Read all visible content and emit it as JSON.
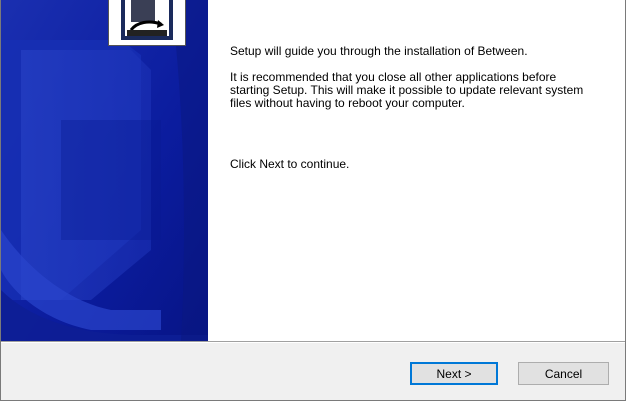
{
  "window": {
    "accent_color": "#0078d7"
  },
  "sidebar": {
    "logo_icon": "installer-box-icon",
    "background_color": "#0a1a9a"
  },
  "content": {
    "intro": "Setup will guide you through the installation of Between.",
    "recommendation": "It is recommended that you close all other applications before starting Setup. This will make it possible to update relevant system files without having to reboot your computer.",
    "instruction": "Click Next to continue."
  },
  "buttons": {
    "next_label": "Next >",
    "cancel_label": "Cancel"
  }
}
